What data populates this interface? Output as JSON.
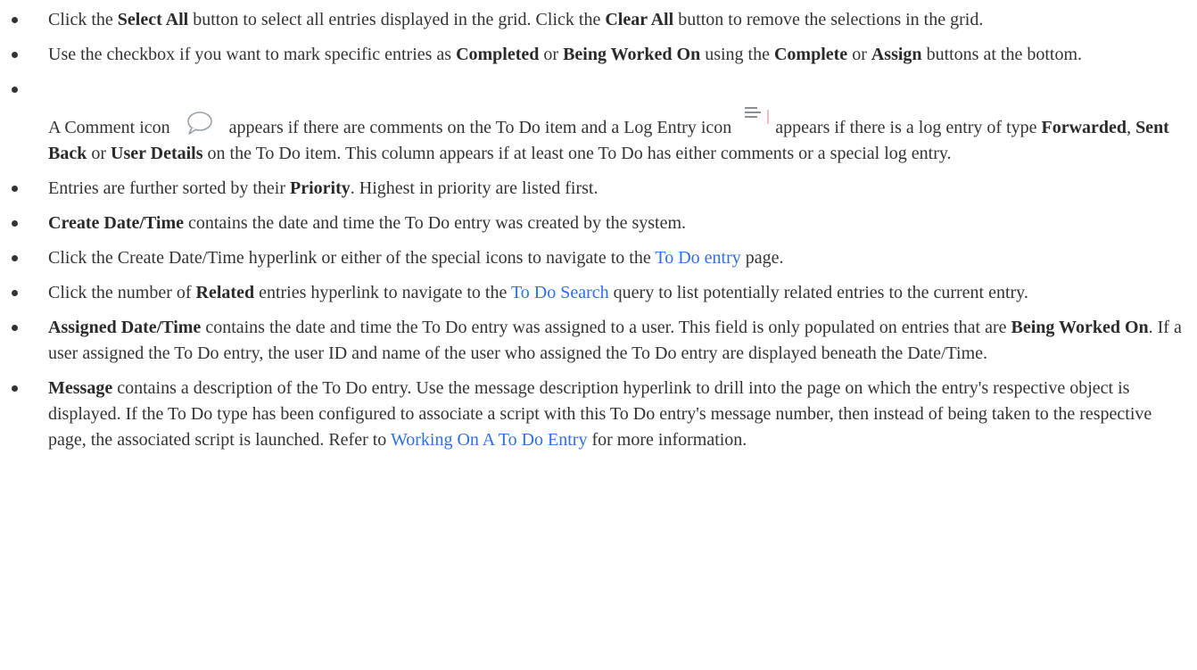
{
  "items": [
    {
      "seg": [
        {
          "t": "Click the "
        },
        {
          "b": "Select All"
        },
        {
          "t": " button to select all entries displayed in the grid. Click the "
        },
        {
          "b": "Clear All"
        },
        {
          "t": " button to remove the selections in the grid."
        }
      ]
    },
    {
      "seg": [
        {
          "t": "Use the checkbox if you want to mark specific entries as "
        },
        {
          "b": "Completed"
        },
        {
          "t": " or "
        },
        {
          "b": "Being Worked On"
        },
        {
          "t": " using the "
        },
        {
          "b": "Complete"
        },
        {
          "t": " or "
        },
        {
          "b": "Assign"
        },
        {
          "t": " buttons at the bottom."
        }
      ]
    },
    {
      "seg": [
        {
          "t": "A Comment icon "
        },
        {
          "icon": "comment-icon"
        },
        {
          "t": " appears if there are comments on the To Do item and a Log Entry icon "
        },
        {
          "icon": "log-entry-icon"
        },
        {
          "t": "appears if there is a log entry of type "
        },
        {
          "b": "Forwarded"
        },
        {
          "t": ", "
        },
        {
          "b": "Sent Back"
        },
        {
          "t": " or "
        },
        {
          "b": "User Details"
        },
        {
          "t": " on the To Do item. This column appears if at least one To Do has either comments or a special log entry."
        }
      ]
    },
    {
      "seg": [
        {
          "t": "Entries are further sorted by their "
        },
        {
          "b": "Priority"
        },
        {
          "t": ". Highest in priority are listed first."
        }
      ]
    },
    {
      "seg": [
        {
          "b": "Create Date/Time"
        },
        {
          "t": " contains the date and time the To Do entry was created by the system."
        }
      ]
    },
    {
      "seg": [
        {
          "t": "Click the Create Date/Time hyperlink or either of the special icons to navigate to the "
        },
        {
          "link": "To Do entry"
        },
        {
          "t": " page."
        }
      ]
    },
    {
      "seg": [
        {
          "t": "Click the number of "
        },
        {
          "b": "Related"
        },
        {
          "t": " entries hyperlink to navigate to the "
        },
        {
          "link": "To Do Search"
        },
        {
          "t": " query to list potentially related entries to the current entry."
        }
      ]
    },
    {
      "seg": [
        {
          "b": "Assigned Date/Time"
        },
        {
          "t": " contains the date and time the To Do entry was assigned to a user. This field is only populated on entries that are "
        },
        {
          "b": "Being Worked On"
        },
        {
          "t": ". If a user assigned the To Do entry, the user ID and name of the user who assigned the To Do entry are displayed beneath the Date/Time."
        }
      ]
    },
    {
      "seg": [
        {
          "b": "Message"
        },
        {
          "t": " contains a description of the To Do entry. Use the message description hyperlink to drill into the page on which the entry's respective object is displayed. If the To Do type has been configured to associate a script with this To Do entry's message number, then instead of being taken to the respective page, the associated script is launched. Refer to "
        },
        {
          "link": "Working On A To Do Entry"
        },
        {
          "t": " for more information."
        }
      ]
    }
  ],
  "colors": {
    "text": "#333333",
    "link": "#2f6fe0",
    "icon": "#9aa0a6"
  }
}
